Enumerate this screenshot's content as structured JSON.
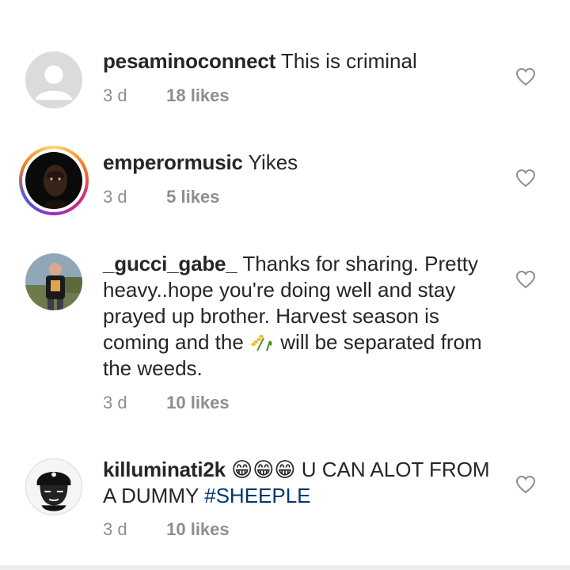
{
  "comments": [
    {
      "username": "pesaminoconnect",
      "text": "This is criminal",
      "time": "3 d",
      "likes": "18 likes",
      "avatar_icon": "default-user-avatar"
    },
    {
      "username": "emperormusic",
      "text": "Yikes",
      "time": "3 d",
      "likes": "5 likes",
      "avatar_icon": "portrait-photo",
      "has_story_ring": true
    },
    {
      "username": "_gucci_gabe_",
      "text_before_emoji": "Thanks for sharing. Pretty heavy..hope you're doing well and stay prayed up brother. Harvest season is coming and the",
      "emoji": "🌾",
      "text_after_emoji": "will be separated from the weeds.",
      "time": "3 d",
      "likes": "10 likes",
      "avatar_icon": "person-outdoor-photo"
    },
    {
      "username": "killuminati2k",
      "emojis": [
        "😁",
        "😁",
        "😁"
      ],
      "text": "U CAN ALOT FROM A DUMMY",
      "hashtag": "#SHEEPLE",
      "time": "3 d",
      "likes": "10 likes",
      "avatar_icon": "bandana-portrait-drawing"
    }
  ],
  "icons": {
    "like": "heart-outline-icon"
  },
  "colors": {
    "text": "#262626",
    "meta": "#8e8e8e",
    "hashtag": "#00376b",
    "heart": "#8e8e8e"
  }
}
